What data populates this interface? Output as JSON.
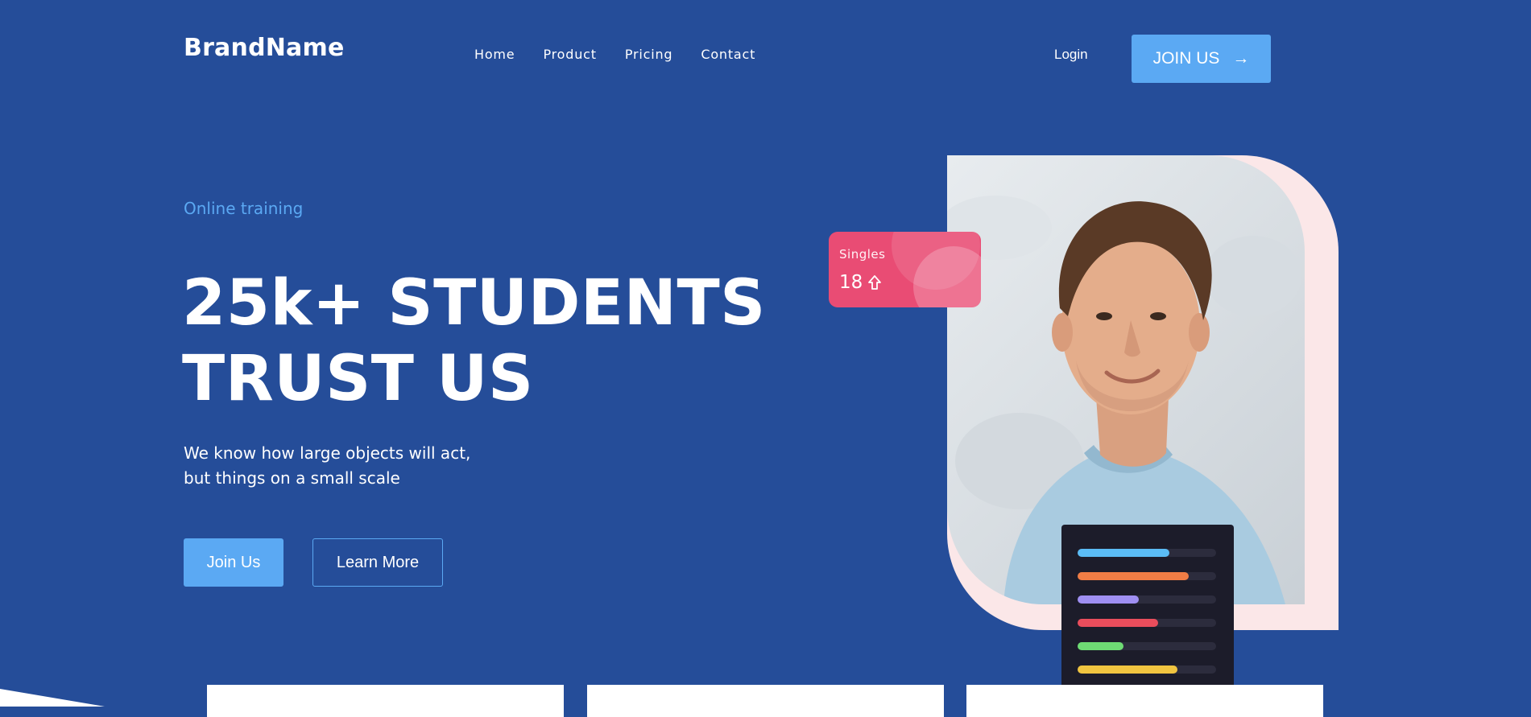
{
  "header": {
    "brand": "BrandName",
    "nav": [
      {
        "label": "Home"
      },
      {
        "label": "Product"
      },
      {
        "label": "Pricing"
      },
      {
        "label": "Contact"
      }
    ],
    "login_label": "Login",
    "join_label": "JOIN US",
    "join_arrow": "→"
  },
  "hero": {
    "eyebrow": "Online training",
    "headline_line1": "25k+ STUDENTS",
    "headline_line2": "TRUST US",
    "description_line1": "We know how large objects will act,",
    "description_line2": "but things on a small scale",
    "primary_button": "Join Us",
    "secondary_button": "Learn More"
  },
  "stat_card": {
    "label": "Singles",
    "value": "18"
  },
  "progress_panel": {
    "bars": [
      {
        "fill": 0.66,
        "color": "#5bbcf5"
      },
      {
        "fill": 0.8,
        "color": "#f07d45"
      },
      {
        "fill": 0.44,
        "color": "#9f8ff2"
      },
      {
        "fill": 0.58,
        "color": "#ea4d5c"
      },
      {
        "fill": 0.33,
        "color": "#6edb74"
      },
      {
        "fill": 0.72,
        "color": "#f0c440"
      }
    ]
  },
  "colors": {
    "background": "#254d99",
    "accent": "#5ba9f3",
    "card_pink": "#e94c74",
    "shape_pink": "#fbe7e8"
  }
}
